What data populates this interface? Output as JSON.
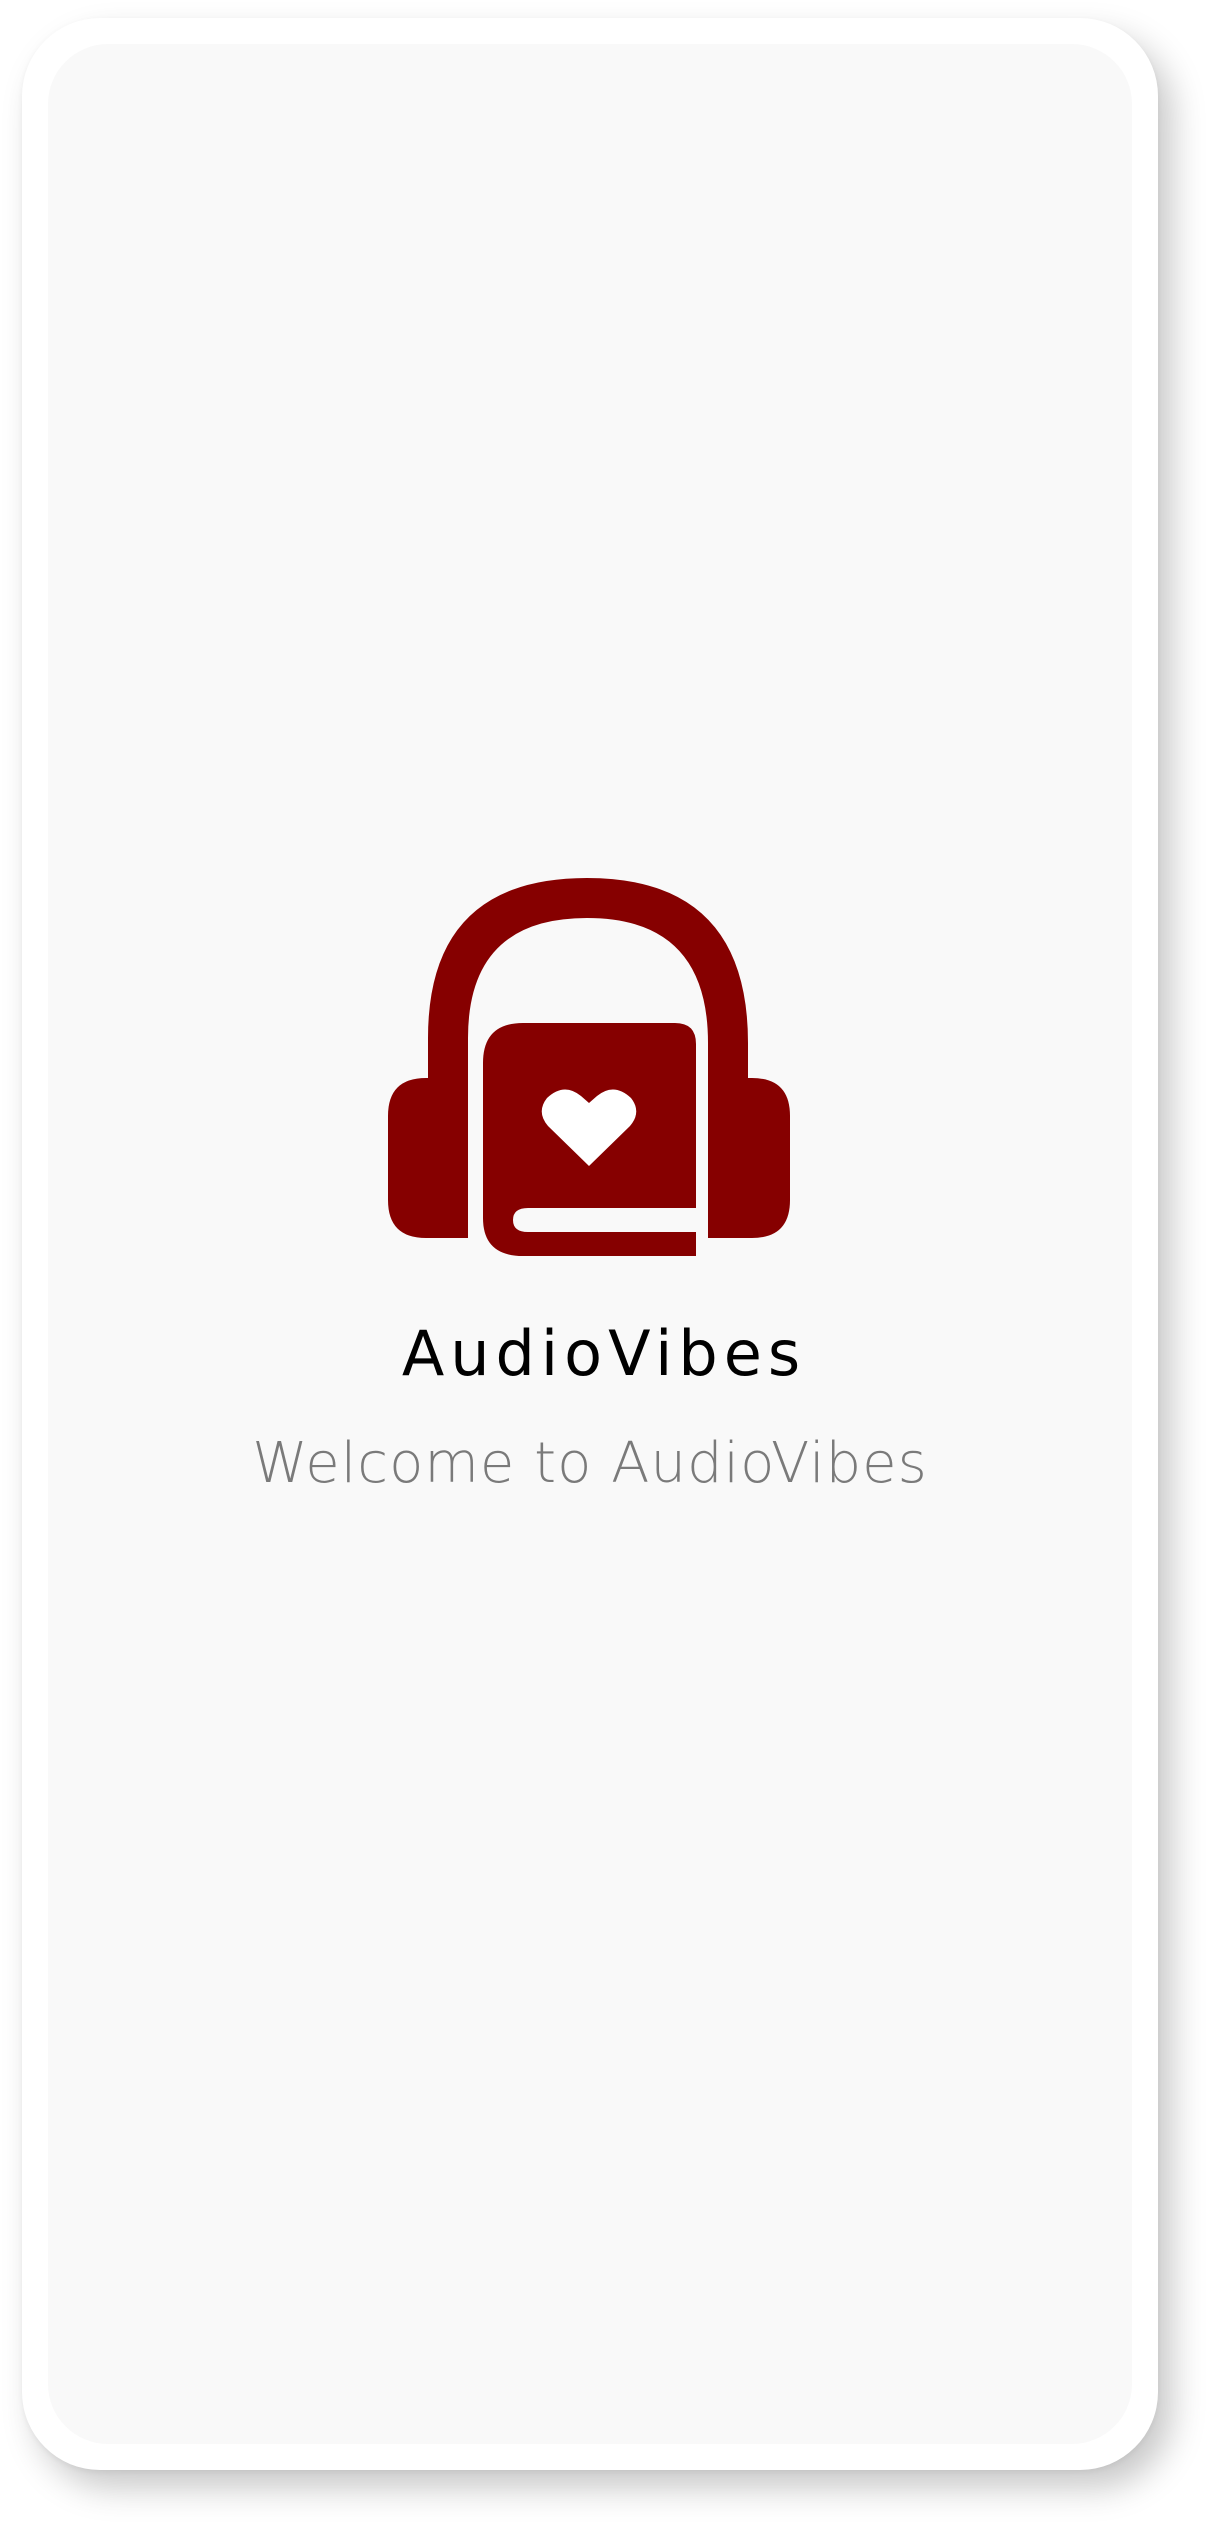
{
  "app": {
    "name": "AudioVibes",
    "welcome_text": "Welcome to AudioVibes"
  },
  "logo": {
    "icon": "headphones-book-heart-icon",
    "color": "#860000"
  },
  "colors": {
    "screen_background": "#f9f9f9",
    "title_text": "#000000",
    "subtitle_text": "#7a7a7a"
  }
}
